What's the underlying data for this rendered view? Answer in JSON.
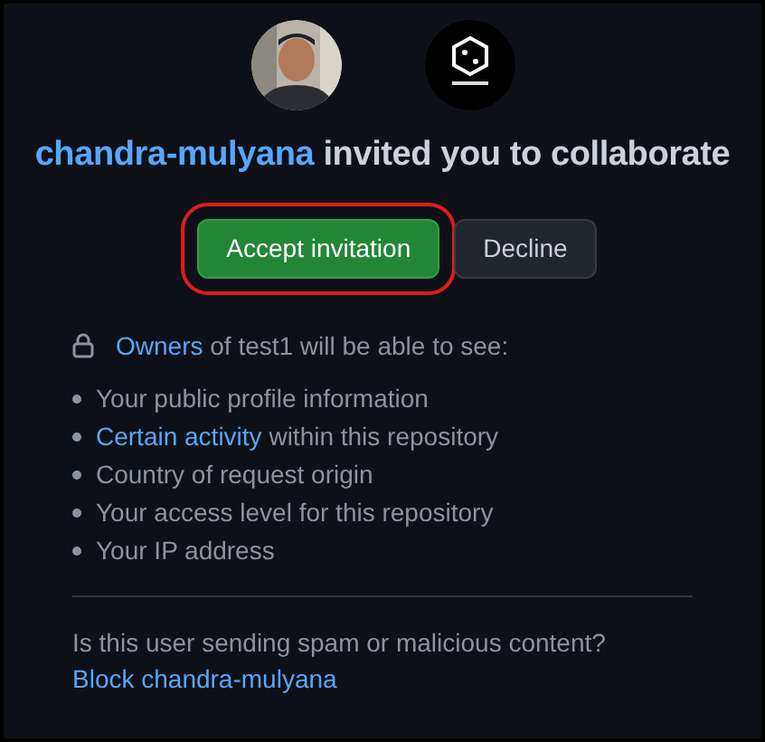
{
  "avatars": [
    {
      "kind": "user"
    },
    {
      "kind": "org"
    }
  ],
  "title": {
    "inviter": "chandra-mulyana",
    "text": "invited you to collaborate"
  },
  "buttons": [
    {
      "label": "Accept invitation",
      "kind": "primary",
      "highlighted": true
    },
    {
      "label": "Decline",
      "kind": "secondary",
      "highlighted": false
    }
  ],
  "notice": {
    "link": "Owners",
    "text": "of test1 will be able to see:"
  },
  "permissions": [
    {
      "text": "Your public profile information"
    },
    {
      "link": "Certain activity",
      "text": "within this repository"
    },
    {
      "text": "Country of request origin"
    },
    {
      "text": "Your access level for this repository"
    },
    {
      "text": "Your IP address"
    }
  ],
  "spam": {
    "question": "Is this user sending spam or malicious content?",
    "link": "Block chandra-mulyana"
  }
}
